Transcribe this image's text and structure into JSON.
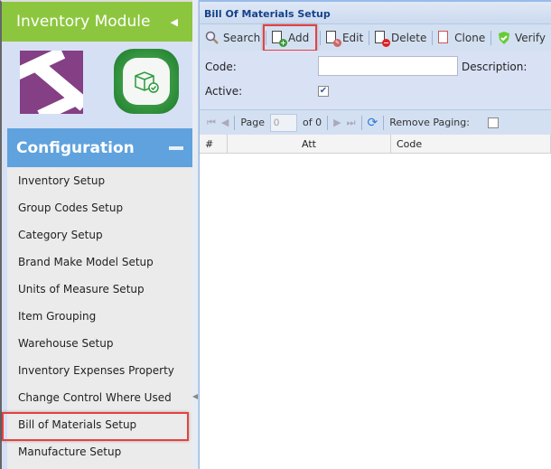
{
  "sidebar": {
    "module_title": "Inventory Module",
    "section_title": "Configuration",
    "items": [
      {
        "label": "Inventory Setup"
      },
      {
        "label": "Group Codes Setup"
      },
      {
        "label": "Category Setup"
      },
      {
        "label": "Brand Make Model Setup"
      },
      {
        "label": "Units of Measure Setup"
      },
      {
        "label": "Item Grouping"
      },
      {
        "label": "Warehouse Setup"
      },
      {
        "label": "Inventory Expenses Property"
      },
      {
        "label": "Change Control Where Used"
      },
      {
        "label": "Bill of Materials Setup"
      },
      {
        "label": "Manufacture Setup"
      }
    ]
  },
  "panel": {
    "title": "Bill Of Materials Setup",
    "toolbar": {
      "search": "Search",
      "add": "Add",
      "edit": "Edit",
      "delete": "Delete",
      "clone": "Clone",
      "verify": "Verify"
    },
    "form": {
      "code_label": "Code:",
      "code_value": "",
      "description_label": "Description:",
      "active_label": "Active:",
      "active_checked": true
    },
    "pager": {
      "page_label": "Page",
      "page_value": "0",
      "of_label": "of 0",
      "remove_paging_label": "Remove Paging:"
    },
    "grid": {
      "columns": [
        "#",
        "Att",
        "Code"
      ]
    }
  }
}
